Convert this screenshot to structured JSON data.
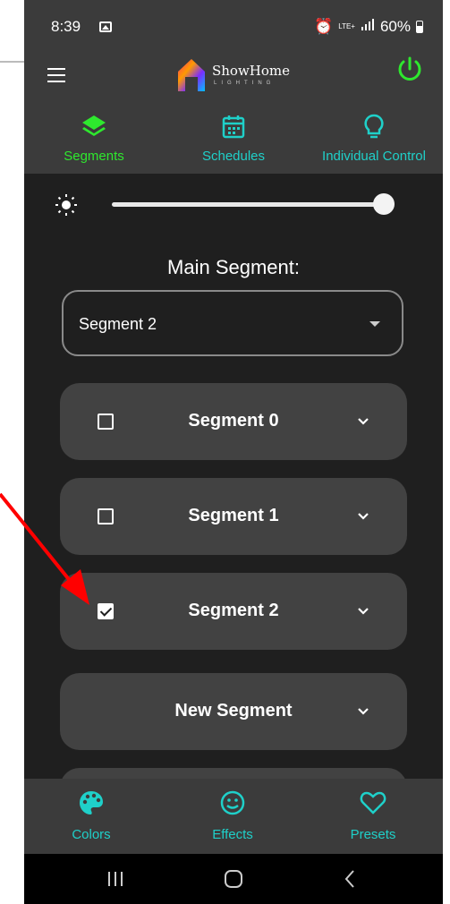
{
  "status": {
    "time": "8:39",
    "lte": "LTE+",
    "battery": "60%"
  },
  "app": {
    "logo_title": "ShowHome",
    "logo_sub": "LIGHTING"
  },
  "top_tabs": [
    {
      "label": "Segments",
      "color": "#2ee82e",
      "active": true
    },
    {
      "label": "Schedules",
      "color": "#1fd0c9"
    },
    {
      "label": "Individual Control",
      "color": "#1fd0c9"
    }
  ],
  "brightness": {
    "level": 1.0
  },
  "main_segment": {
    "label": "Main Segment:",
    "selected": "Segment 2"
  },
  "segments": [
    {
      "name": "Segment 0",
      "checked": false
    },
    {
      "name": "Segment 1",
      "checked": false
    },
    {
      "name": "Segment 2",
      "checked": true
    },
    {
      "name": "New Segment"
    }
  ],
  "bottom_tabs": [
    {
      "label": "Colors",
      "icon": "palette-icon"
    },
    {
      "label": "Effects",
      "icon": "smiley-icon"
    },
    {
      "label": "Presets",
      "icon": "heart-icon"
    }
  ],
  "colors": {
    "accent_green": "#2ee82e",
    "accent_teal": "#1fd0c9",
    "annotation_red": "#ff0000"
  }
}
